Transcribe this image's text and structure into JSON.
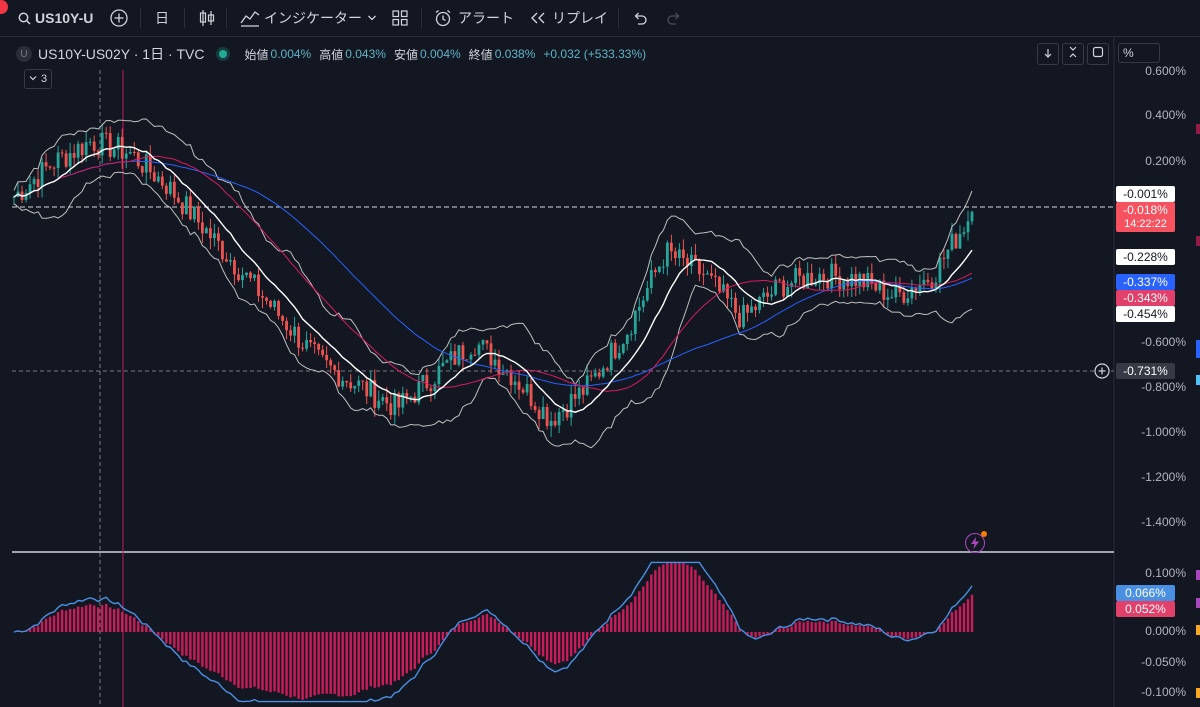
{
  "toolbar": {
    "symbol": "US10Y-U",
    "interval": "日",
    "indicators_label": "インジケーター",
    "alert_label": "アラート",
    "replay_label": "リプレイ"
  },
  "legend": {
    "symbol_badge": "U",
    "title": "US10Y-US02Y · 1日 · TVC",
    "open_label": "始値",
    "open_value": "0.004%",
    "high_label": "高値",
    "high_value": "0.043%",
    "low_label": "安値",
    "low_value": "0.004%",
    "close_label": "終値",
    "close_value": "0.038%",
    "change_value": "+0.032 (+533.33%)",
    "indicator_count": "3"
  },
  "scale_mode": "%",
  "price_axis": [
    "0.600%",
    "0.400%",
    "0.200%",
    "-0.600%",
    "-0.800%",
    "-1.000%",
    "-1.200%",
    "-1.400%"
  ],
  "price_tags": {
    "bb_upper": "-0.001%",
    "last_price": "-0.018%",
    "countdown": "14:22:22",
    "bb_basis": "-0.228%",
    "ma_blue": "-0.337%",
    "ma_red": "-0.343%",
    "bb_lower": "-0.454%",
    "crosshair": "-0.731%"
  },
  "macd_axis": [
    "0.100%",
    "0.050%",
    "0.000%",
    "-0.050%",
    "-0.100%"
  ],
  "macd_tags": {
    "macd": "0.066%",
    "hist": "0.052%"
  },
  "colors": {
    "bg": "#131722",
    "up": "#26a69a",
    "down": "#ef5350",
    "bb": "#c8c8c8",
    "basis": "#ffffff",
    "ma_red": "#e0406a",
    "ma_blue": "#2962ff",
    "macd_line": "#4a90e2",
    "hist": "#e91e63"
  },
  "chart_data": {
    "type": "line",
    "title": "US10Y-US02Y",
    "description_series": [
      {
        "name": "price",
        "values": [
          0.05,
          0.2,
          0.3,
          0.25,
          0.1,
          -0.1,
          -0.3,
          -0.5,
          -0.7,
          -0.8,
          -0.9,
          -0.75,
          -0.6,
          -0.75,
          -0.95,
          -0.8,
          -0.55,
          -0.2,
          -0.3,
          -0.5,
          -0.35,
          -0.3,
          -0.32,
          -0.4,
          -0.3,
          -0.018
        ]
      }
    ],
    "ylim": [
      -1.45,
      0.62
    ]
  }
}
